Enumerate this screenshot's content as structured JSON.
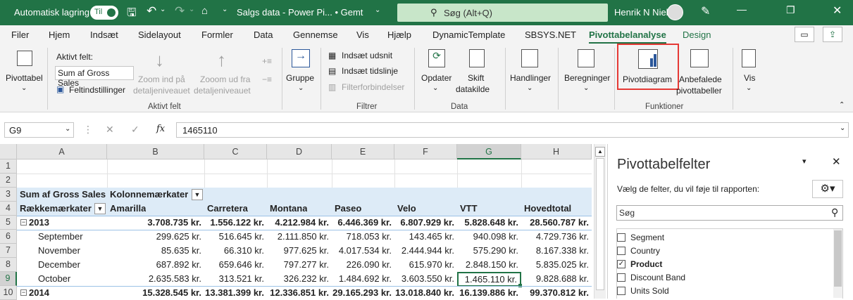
{
  "title": {
    "autosave": "Automatisk lagring",
    "autosave_state": "Til",
    "file": "Salgs data - Power Pi... • Gemt",
    "search": "Søg (Alt+Q)",
    "user": "Henrik N Nielsen"
  },
  "menu": [
    "Filer",
    "Hjem",
    "Indsæt",
    "Sidelayout",
    "Formler",
    "Data",
    "Gennemse",
    "Vis",
    "Hjælp",
    "DynamicTemplate",
    "SBSYS.NET",
    "Pivottabelanalyse",
    "Design"
  ],
  "ribbon": {
    "pivot": "Pivottabel",
    "active_field_label": "Aktivt felt:",
    "active_field_value": "Sum af Gross Sales",
    "field_settings": "Feltindstillinger",
    "zoom_in": [
      "Zoom ind på",
      "detaljeniveauet"
    ],
    "zoom_out": [
      "Zooom ud fra",
      "detaljeniveauet"
    ],
    "group": "Gruppe",
    "insert_slicer": "Indsæt udsnit",
    "insert_timeline": "Indsæt tidslinje",
    "filter_conn": "Filterforbindelser",
    "refresh": "Opdater",
    "change_source": [
      "Skift",
      "datakilde"
    ],
    "actions": "Handlinger",
    "calcs": "Beregninger",
    "pivotchart": "Pivotdiagram",
    "recommended": [
      "Anbefalede",
      "pivottabeller"
    ],
    "show": "Vis",
    "groups": {
      "active": "Aktivt felt",
      "filter": "Filtrer",
      "data": "Data",
      "func": "Funktioner"
    }
  },
  "formula": {
    "namebox": "G9",
    "value": "1465110"
  },
  "grid": {
    "columns": [
      "A",
      "B",
      "C",
      "D",
      "E",
      "F",
      "G",
      "H"
    ],
    "rows": [
      "1",
      "2",
      "3",
      "4",
      "5",
      "6",
      "7",
      "8",
      "9",
      "10"
    ],
    "r3": [
      "Sum af Gross Sales",
      "Kolonnemærkater"
    ],
    "r4": [
      "Rækkemærkater",
      "Amarilla",
      "Carretera",
      "Montana",
      "Paseo",
      "Velo",
      "VTT",
      "Hovedtotal"
    ],
    "data": [
      [
        "2013",
        "3.708.735 kr.",
        "1.556.122 kr.",
        "4.212.984 kr.",
        "6.446.369 kr.",
        "6.807.929 kr.",
        "5.828.648 kr.",
        "28.560.787 kr."
      ],
      [
        "September",
        "299.625 kr.",
        "516.645 kr.",
        "2.111.850 kr.",
        "718.053 kr.",
        "143.465 kr.",
        "940.098 kr.",
        "4.729.736 kr."
      ],
      [
        "November",
        "85.635 kr.",
        "66.310 kr.",
        "977.625 kr.",
        "4.017.534 kr.",
        "2.444.944 kr.",
        "575.290 kr.",
        "8.167.338 kr."
      ],
      [
        "December",
        "687.892 kr.",
        "659.646 kr.",
        "797.277 kr.",
        "226.090 kr.",
        "615.970 kr.",
        "2.848.150 kr.",
        "5.835.025 kr."
      ],
      [
        "October",
        "2.635.583 kr.",
        "313.521 kr.",
        "326.232 kr.",
        "1.484.692 kr.",
        "3.603.550 kr.",
        "1.465.110 kr.",
        "9.828.688 kr."
      ],
      [
        "2014",
        "15.328.545 kr.",
        "13.381.399 kr.",
        "12.336.851 kr.",
        "29.165.293 kr.",
        "13.018.840 kr.",
        "16.139.886 kr.",
        "99.370.812 kr."
      ]
    ]
  },
  "pane": {
    "title": "Pivottabelfelter",
    "subtitle": "Vælg de felter, du vil føje til rapporten:",
    "search": "Søg",
    "fields": [
      {
        "name": "Segment",
        "checked": false
      },
      {
        "name": "Country",
        "checked": false
      },
      {
        "name": "Product",
        "checked": true
      },
      {
        "name": "Discount Band",
        "checked": false
      },
      {
        "name": "Units Sold",
        "checked": false
      }
    ]
  }
}
